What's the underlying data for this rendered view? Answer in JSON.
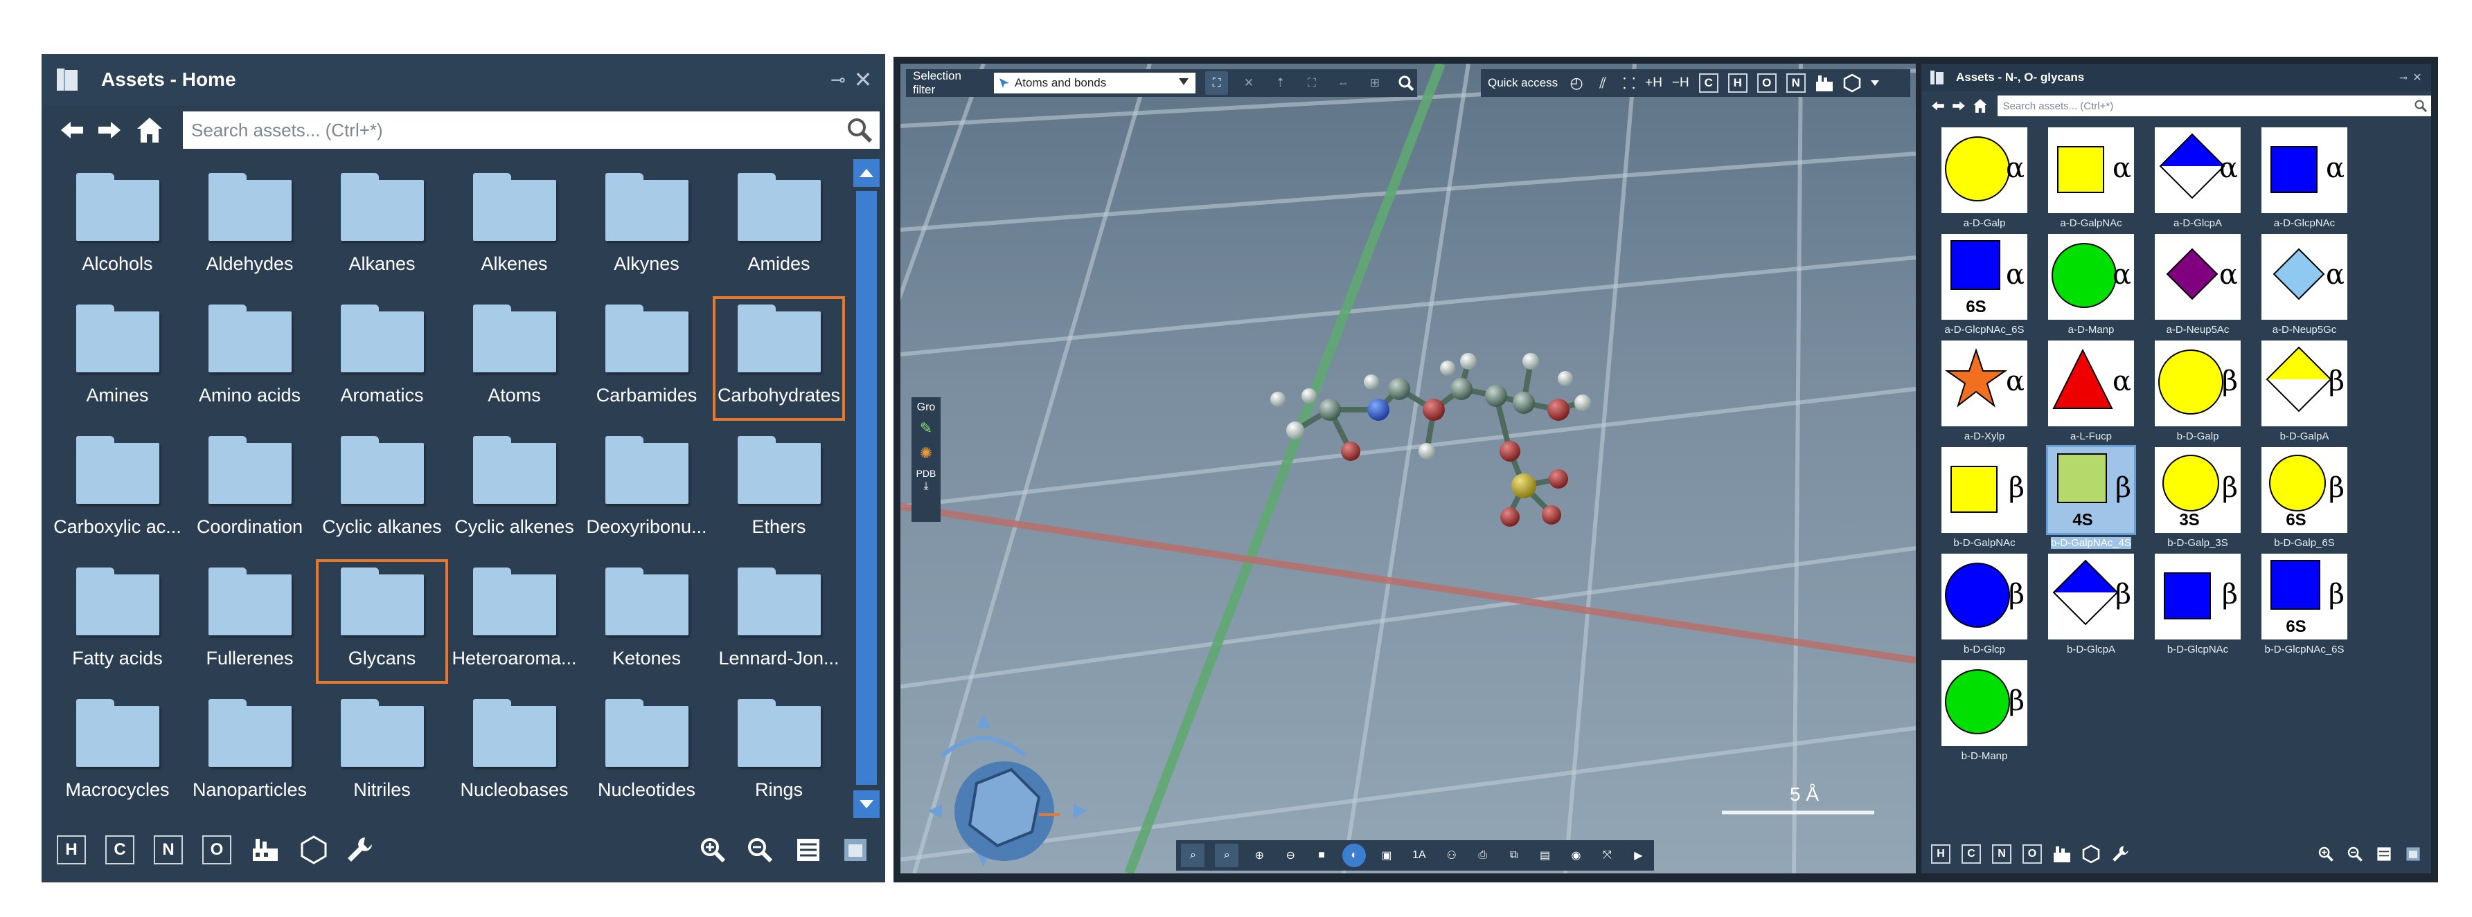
{
  "left_panel": {
    "title": "Assets - Home",
    "search_placeholder": "Search assets... (Ctrl+*)",
    "folders": [
      {
        "label": "Alcohols"
      },
      {
        "label": "Aldehydes"
      },
      {
        "label": "Alkanes"
      },
      {
        "label": "Alkenes"
      },
      {
        "label": "Alkynes"
      },
      {
        "label": "Amides"
      },
      {
        "label": "Amines"
      },
      {
        "label": "Amino acids"
      },
      {
        "label": "Aromatics"
      },
      {
        "label": "Atoms"
      },
      {
        "label": "Carbamides"
      },
      {
        "label": "Carbohydrates"
      },
      {
        "label": "Carboxylic ac..."
      },
      {
        "label": "Coordination"
      },
      {
        "label": "Cyclic alkanes"
      },
      {
        "label": "Cyclic alkenes"
      },
      {
        "label": "Deoxyribonu..."
      },
      {
        "label": "Ethers"
      },
      {
        "label": "Fatty acids"
      },
      {
        "label": "Fullerenes"
      },
      {
        "label": "Glycans"
      },
      {
        "label": "Heteroaroma..."
      },
      {
        "label": "Ketones"
      },
      {
        "label": "Lennard-Jon..."
      },
      {
        "label": "Macrocycles"
      },
      {
        "label": "Nanoparticles"
      },
      {
        "label": "Nitriles"
      },
      {
        "label": "Nucleobases"
      },
      {
        "label": "Nucleotides"
      },
      {
        "label": "Rings"
      }
    ],
    "highlighted": [
      "Carbohydrates",
      "Glycans"
    ],
    "bottom_letters": [
      "H",
      "C",
      "N",
      "O"
    ]
  },
  "viewport": {
    "selection_filter_label": "Selection filter",
    "selection_filter_value": "Atoms and bonds",
    "quick_access_label": "Quick access",
    "add_h_label": "+H",
    "remove_h_label": "−H",
    "quick_letters": [
      "C",
      "H",
      "O",
      "N"
    ],
    "side_tool_label": "Gro",
    "pdb_label": "PDB",
    "scale_label": "5 Å"
  },
  "right_panel": {
    "title": "Assets - N-, O- glycans",
    "search_placeholder": "Search assets... (Ctrl+*)",
    "tiles": [
      {
        "label": "a-D-Galp",
        "shape": "circle",
        "color": "#ffff00",
        "greek": "α",
        "sub": ""
      },
      {
        "label": "a-D-GalpNAc",
        "shape": "square",
        "color": "#ffff00",
        "greek": "α",
        "sub": ""
      },
      {
        "label": "a-D-GlcpA",
        "shape": "diamond-half",
        "color": "#0000ff",
        "greek": "α",
        "sub": ""
      },
      {
        "label": "a-D-GlcpNAc",
        "shape": "square",
        "color": "#0000ff",
        "greek": "α",
        "sub": ""
      },
      {
        "label": "a-D-GlcpNAc_6S",
        "shape": "square",
        "color": "#0000ff",
        "greek": "α",
        "sub": "6S"
      },
      {
        "label": "a-D-Manp",
        "shape": "circle",
        "color": "#00e000",
        "greek": "α",
        "sub": ""
      },
      {
        "label": "a-D-Neup5Ac",
        "shape": "diamond",
        "color": "#800080",
        "greek": "α",
        "sub": ""
      },
      {
        "label": "a-D-Neup5Gc",
        "shape": "diamond",
        "color": "#8fc8f0",
        "greek": "α",
        "sub": ""
      },
      {
        "label": "a-D-Xylp",
        "shape": "star",
        "color": "#f07020",
        "greek": "α",
        "sub": ""
      },
      {
        "label": "a-L-Fucp",
        "shape": "triangle",
        "color": "#ee0000",
        "greek": "α",
        "sub": ""
      },
      {
        "label": "b-D-Galp",
        "shape": "circle",
        "color": "#ffff00",
        "greek": "β",
        "sub": ""
      },
      {
        "label": "b-D-GalpA",
        "shape": "diamond-half",
        "color": "#ffff00",
        "greek": "β",
        "sub": ""
      },
      {
        "label": "b-D-GalpNAc",
        "shape": "square",
        "color": "#ffff00",
        "greek": "β",
        "sub": ""
      },
      {
        "label": "b-D-GalpNAc_4S",
        "shape": "square",
        "color": "#b5d96b",
        "greek": "β",
        "sub": "4S",
        "selected": true
      },
      {
        "label": "b-D-Galp_3S",
        "shape": "circle",
        "color": "#ffff00",
        "greek": "β",
        "sub": "3S"
      },
      {
        "label": "b-D-Galp_6S",
        "shape": "circle",
        "color": "#ffff00",
        "greek": "β",
        "sub": "6S"
      },
      {
        "label": "b-D-Glcp",
        "shape": "circle",
        "color": "#0000ff",
        "greek": "β",
        "sub": ""
      },
      {
        "label": "b-D-GlcpA",
        "shape": "diamond-half",
        "color": "#0000ff",
        "greek": "β",
        "sub": ""
      },
      {
        "label": "b-D-GlcpNAc",
        "shape": "square",
        "color": "#0000ff",
        "greek": "β",
        "sub": ""
      },
      {
        "label": "b-D-GlcpNAc_6S",
        "shape": "square",
        "color": "#0000ff",
        "greek": "β",
        "sub": "6S"
      },
      {
        "label": "b-D-Manp",
        "shape": "circle",
        "color": "#00e000",
        "greek": "β",
        "sub": ""
      }
    ],
    "bottom_letters": [
      "H",
      "C",
      "N",
      "O"
    ]
  },
  "colors": {
    "panel_bg": "#2b3e52",
    "highlight": "#e5782c",
    "folder": "#a8cbe8",
    "axis_green": "#5fa872",
    "axis_red": "#b86f6a"
  }
}
